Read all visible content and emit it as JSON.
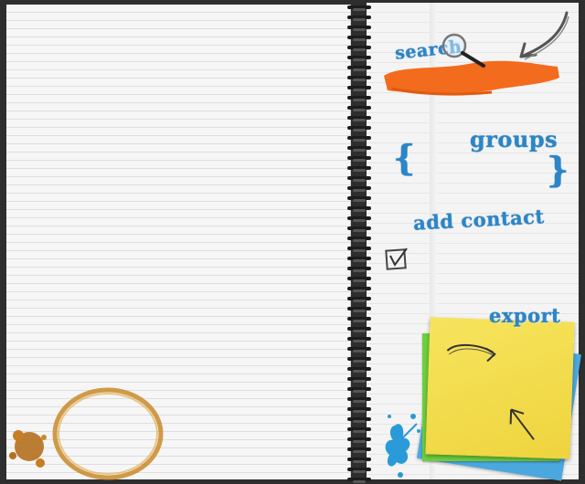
{
  "nav": {
    "search_label": "search",
    "groups_label": "groups",
    "add_contact_label": "add contact",
    "export_label": "export",
    "brace_open": "{",
    "brace_close": "}"
  },
  "colors": {
    "nav_text": "#2a86c8",
    "search_smear": "#f36b1c",
    "note_yellow": "#f3de4e",
    "note_blue": "#4aa8de",
    "note_green": "#6fcf3e",
    "background": "#2e2e2e",
    "paper": "#f6f6f6",
    "coffee_stain": "#c98a2a"
  },
  "icons": {
    "search": "magnifier-icon",
    "checkbox": "checkbox-icon",
    "arrow": "curved-arrow-icon",
    "spiral": "spiral-binding"
  }
}
